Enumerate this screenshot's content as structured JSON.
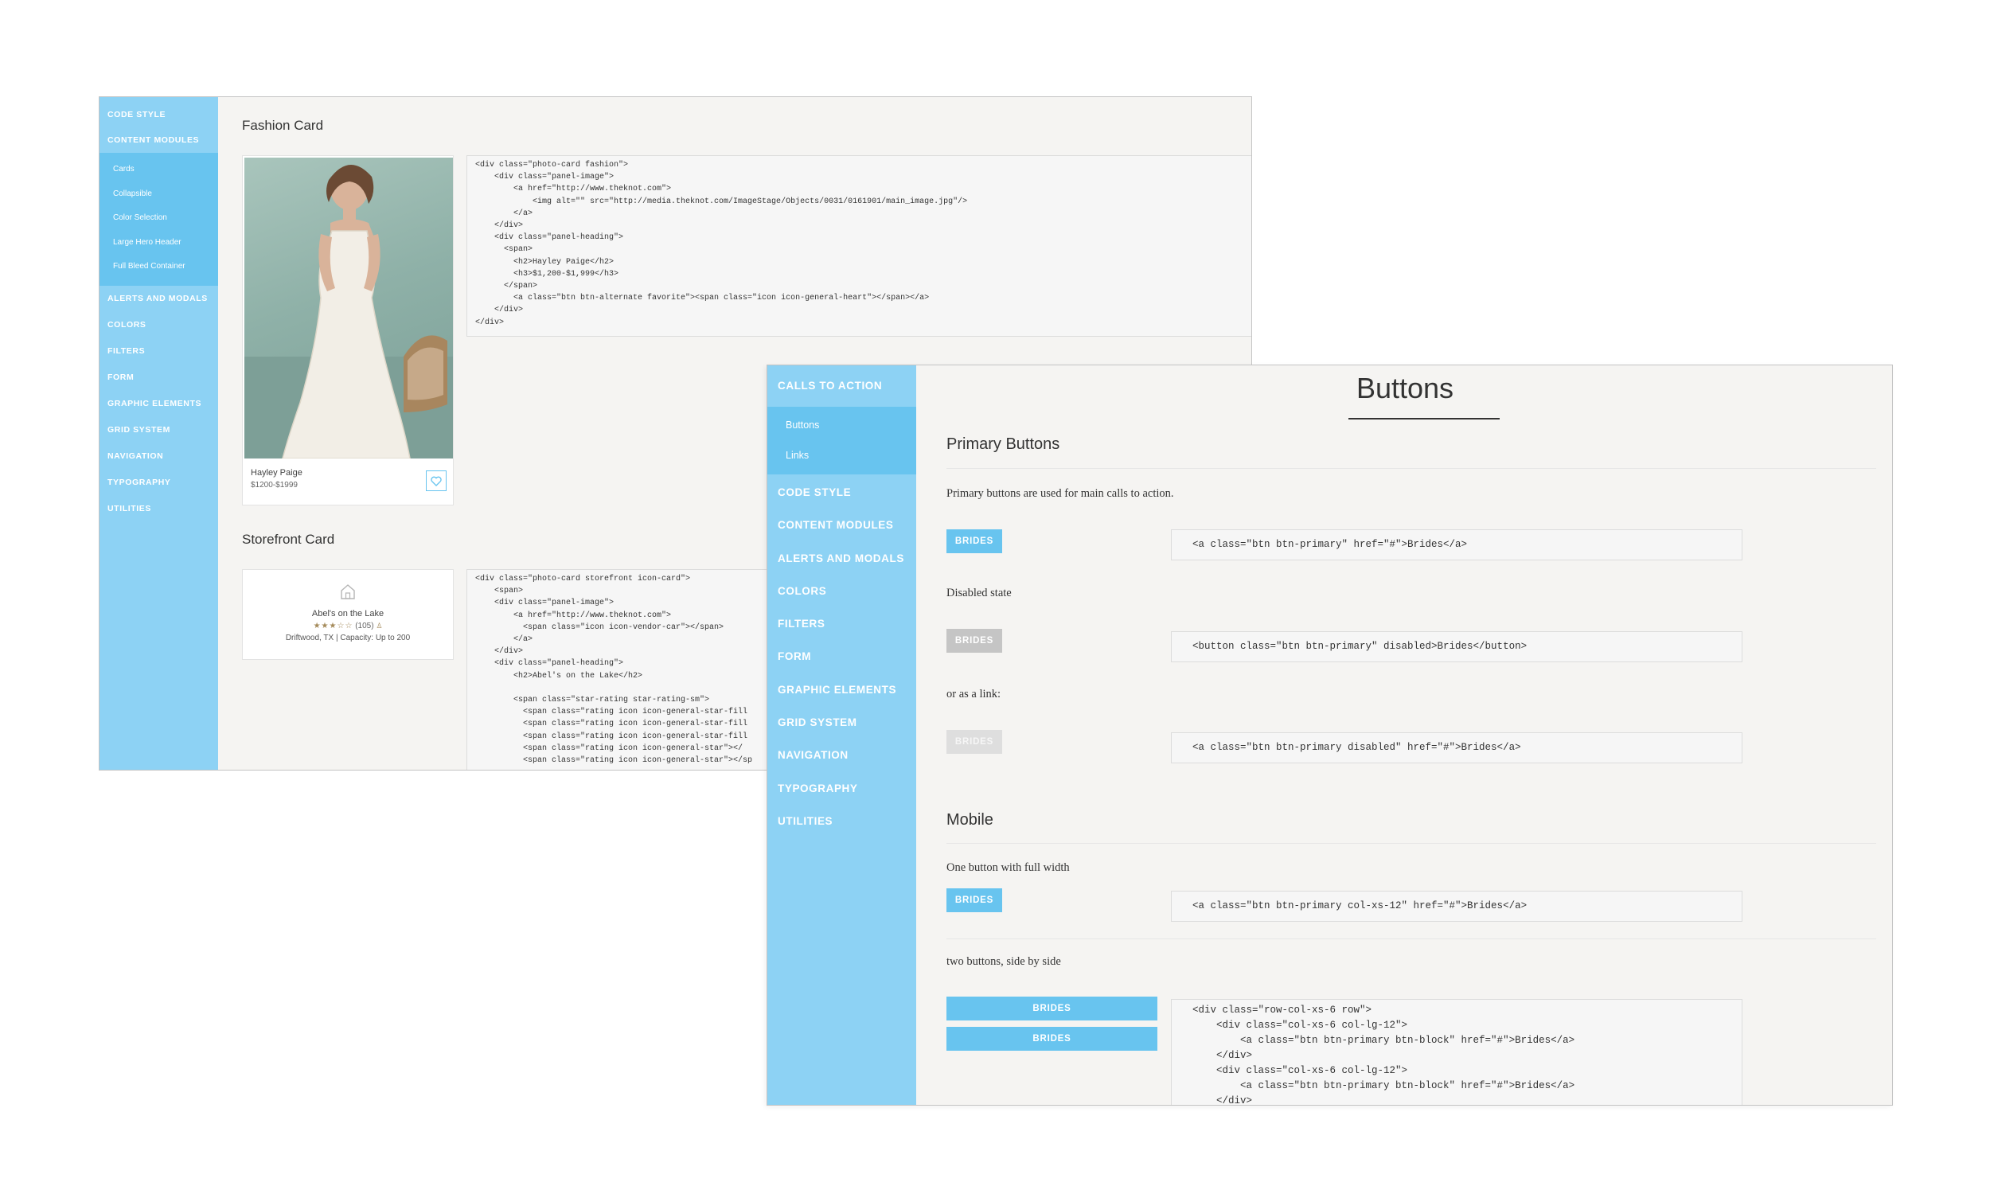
{
  "window_back": {
    "sidebar": {
      "top_items": [
        "CODE STYLE",
        "CONTENT MODULES"
      ],
      "sub_items": [
        "Cards",
        "Collapsible",
        "Color Selection",
        "Large Hero Header",
        "Full Bleed Container"
      ],
      "bottom_items": [
        "ALERTS AND MODALS",
        "COLORS",
        "FILTERS",
        "FORM",
        "GRAPHIC ELEMENTS",
        "GRID SYSTEM",
        "NAVIGATION",
        "TYPOGRAPHY",
        "UTILITIES"
      ]
    },
    "fashion": {
      "title": "Fashion Card",
      "card_name": "Hayley Paige",
      "card_price": "$1200-$1999",
      "code": [
        "<div class=\"photo-card fashion\">",
        "    <div class=\"panel-image\">",
        "        <a href=\"http://www.theknot.com\">",
        "            <img alt=\"\" src=\"http://media.theknot.com/ImageStage/Objects/0031/0161901/main_image.jpg\"/>",
        "        </a>",
        "    </div>",
        "    <div class=\"panel-heading\">",
        "      <span>",
        "        <h2>Hayley Paige</h2>",
        "        <h3>$1,200-$1,999</h3>",
        "      </span>",
        "        <a class=\"btn btn-alternate favorite\"><span class=\"icon icon-general-heart\"></span></a>",
        "    </div>",
        "</div>"
      ]
    },
    "storefront": {
      "title": "Storefront Card",
      "vendor_name": "Abel's on the Lake",
      "stars": "★★★☆☆",
      "review_count": "(105)",
      "location": "Driftwood, TX | Capacity: Up to 200",
      "code": [
        "<div class=\"photo-card storefront icon-card\">",
        "    <span>",
        "    <div class=\"panel-image\">",
        "        <a href=\"http://www.theknot.com\">",
        "          <span class=\"icon icon-vendor-car\"></span>",
        "        </a>",
        "    </div>",
        "    <div class=\"panel-heading\">",
        "        <h2>Abel's on the Lake</h2>",
        "",
        "        <span class=\"star-rating star-rating-sm\">",
        "          <span class=\"rating icon icon-general-star-fill",
        "          <span class=\"rating icon icon-general-star-fill",
        "          <span class=\"rating icon icon-general-star-fill",
        "          <span class=\"rating icon icon-general-star\"></",
        "          <span class=\"rating icon icon-general-star\"></sp"
      ]
    }
  },
  "window_front": {
    "sidebar": {
      "top_items": [
        "CALLS TO ACTION"
      ],
      "sub_items": [
        "Buttons",
        "Links"
      ],
      "bottom_items": [
        "CODE STYLE",
        "CONTENT MODULES",
        "ALERTS AND MODALS",
        "COLORS",
        "FILTERS",
        "FORM",
        "GRAPHIC ELEMENTS",
        "GRID SYSTEM",
        "NAVIGATION",
        "TYPOGRAPHY",
        "UTILITIES"
      ]
    },
    "page_title": "Buttons",
    "primary": {
      "heading": "Primary Buttons",
      "description": "Primary buttons are used for main calls to action.",
      "button_label": "BRIDES",
      "code_primary": "<a class=\"btn btn-primary\" href=\"#\">Brides</a>",
      "disabled_label": "Disabled state",
      "code_disabled": "<button class=\"btn btn-primary\" disabled>Brides</button>",
      "link_label": "or as a link:",
      "code_link": "<a class=\"btn btn-primary disabled\" href=\"#\">Brides</a>"
    },
    "mobile": {
      "heading": "Mobile",
      "full_width_label": "One button with full width",
      "code_full": "<a class=\"btn btn-primary col-xs-12\" href=\"#\">Brides</a>",
      "side_by_side_label": "two buttons, side by side",
      "button_label": "BRIDES",
      "code_side": [
        "<div class=\"row-col-xs-6 row\">",
        "    <div class=\"col-xs-6 col-lg-12\">",
        "        <a class=\"btn btn-primary btn-block\" href=\"#\">Brides</a>",
        "    </div>",
        "    <div class=\"col-xs-6 col-lg-12\">",
        "        <a class=\"btn btn-primary btn-block\" href=\"#\">Brides</a>",
        "    </div>"
      ]
    }
  },
  "colors": {
    "sidebar": "#8dd2f4",
    "sidebar_selected": "#68c4ef",
    "button_primary": "#68c4ef",
    "button_disabled": "#c5c5c5",
    "content_bg": "#f5f4f2"
  }
}
